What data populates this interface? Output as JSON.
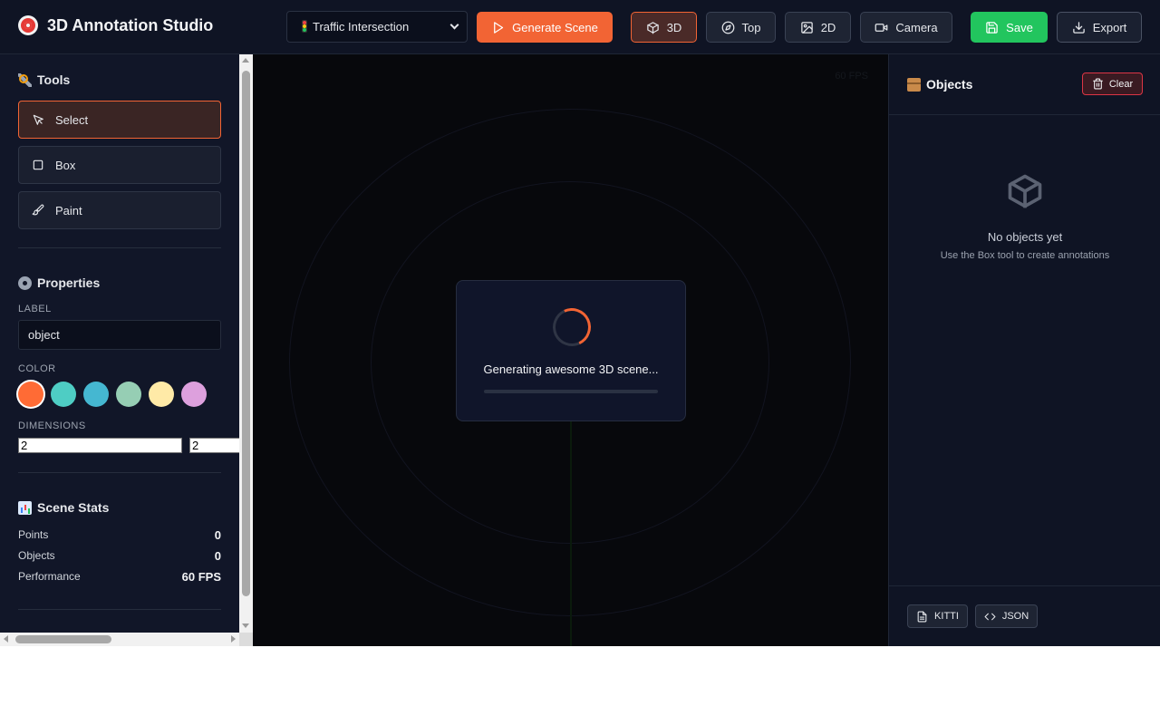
{
  "header": {
    "title": "3D Annotation Studio",
    "scene_select": "Traffic Intersection",
    "generate_label": "Generate Scene",
    "view_3d": "3D",
    "view_top": "Top",
    "view_2d": "2D",
    "camera": "Camera",
    "save": "Save",
    "export": "Export"
  },
  "tools": {
    "title": "Tools",
    "items": [
      {
        "label": "Select",
        "icon": "pointer-icon",
        "active": true
      },
      {
        "label": "Box",
        "icon": "square-icon",
        "active": false
      },
      {
        "label": "Paint",
        "icon": "paintbrush-icon",
        "active": false
      }
    ]
  },
  "properties": {
    "title": "Properties",
    "label_heading": "LABEL",
    "label_value": "object",
    "color_heading": "COLOR",
    "colors": [
      "#ff6b35",
      "#4ecdc4",
      "#45b7d1",
      "#96ceb4",
      "#ffeaa7",
      "#dda0dd"
    ],
    "selected_color": "#ff6b35",
    "dimensions_heading": "DIMENSIONS",
    "dimensions": [
      "2",
      "2"
    ]
  },
  "stats": {
    "title": "Scene Stats",
    "rows": [
      {
        "label": "Points",
        "value": "0"
      },
      {
        "label": "Objects",
        "value": "0"
      },
      {
        "label": "Performance",
        "value": "60 FPS"
      }
    ]
  },
  "viewport": {
    "loading_text": "Generating awesome 3D scene...",
    "progress": 0
  },
  "objects_panel": {
    "title": "Objects",
    "clear_label": "Clear",
    "empty_title": "No objects yet",
    "empty_hint": "Use the Box tool to create annotations",
    "export_kitti": "KITTI",
    "export_json": "JSON"
  }
}
